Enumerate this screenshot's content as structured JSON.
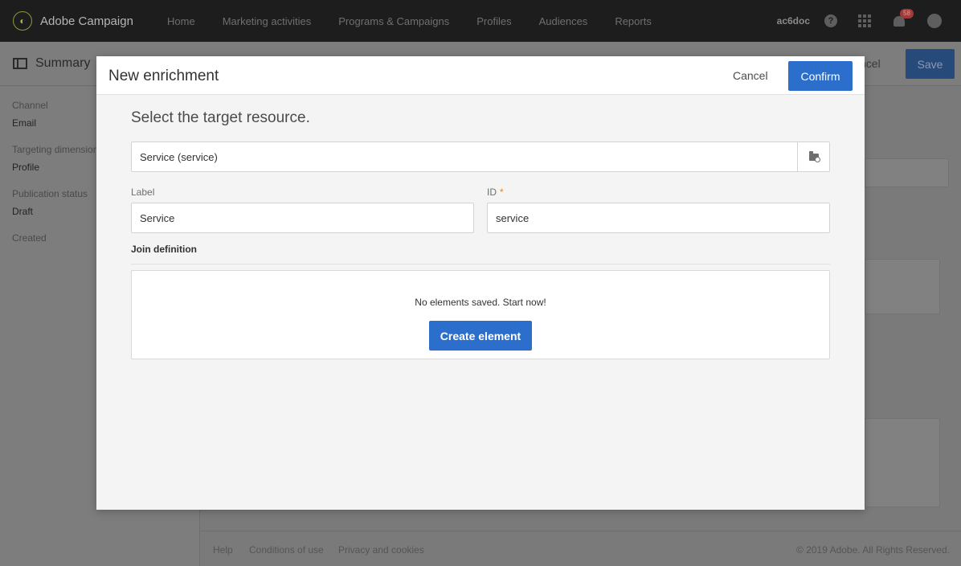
{
  "app": {
    "name": "Adobe Campaign",
    "nav": [
      "Home",
      "Marketing activities",
      "Programs & Campaigns",
      "Profiles",
      "Audiences",
      "Reports"
    ],
    "user": "ac6doc",
    "help_glyph": "?",
    "notification_count": "58"
  },
  "page": {
    "title": "Summary",
    "cancel_label": "ncel",
    "save_label": "Save",
    "sidebar": [
      {
        "label": "Channel",
        "value": "Email"
      },
      {
        "label": "Targeting dimension",
        "value": "Profile"
      },
      {
        "label": "Publication status",
        "value": "Draft"
      },
      {
        "label": "Created",
        "value": ""
      }
    ],
    "footer": {
      "links": [
        "Help",
        "Conditions of use",
        "Privacy and cookies"
      ],
      "copyright": "© 2019 Adobe. All Rights Reserved."
    }
  },
  "modal": {
    "title": "New enrichment",
    "cancel_label": "Cancel",
    "confirm_label": "Confirm",
    "section_title": "Select the target resource.",
    "resource_value": "Service (service)",
    "label_field": {
      "label": "Label",
      "value": "Service"
    },
    "id_field": {
      "label": "ID",
      "required_mark": "*",
      "value": "service"
    },
    "join_title": "Join definition",
    "empty_text": "No elements saved. Start now!",
    "create_label": "Create element"
  },
  "colors": {
    "accent": "#2c6ecb",
    "topbar": "#1d1d1d",
    "overlay": "#7a7a7a"
  },
  "icons": [
    "app-logo-icon",
    "help-icon",
    "apps-grid-icon",
    "bell-icon",
    "avatar-icon",
    "summary-panel-icon",
    "folder-picker-icon"
  ]
}
